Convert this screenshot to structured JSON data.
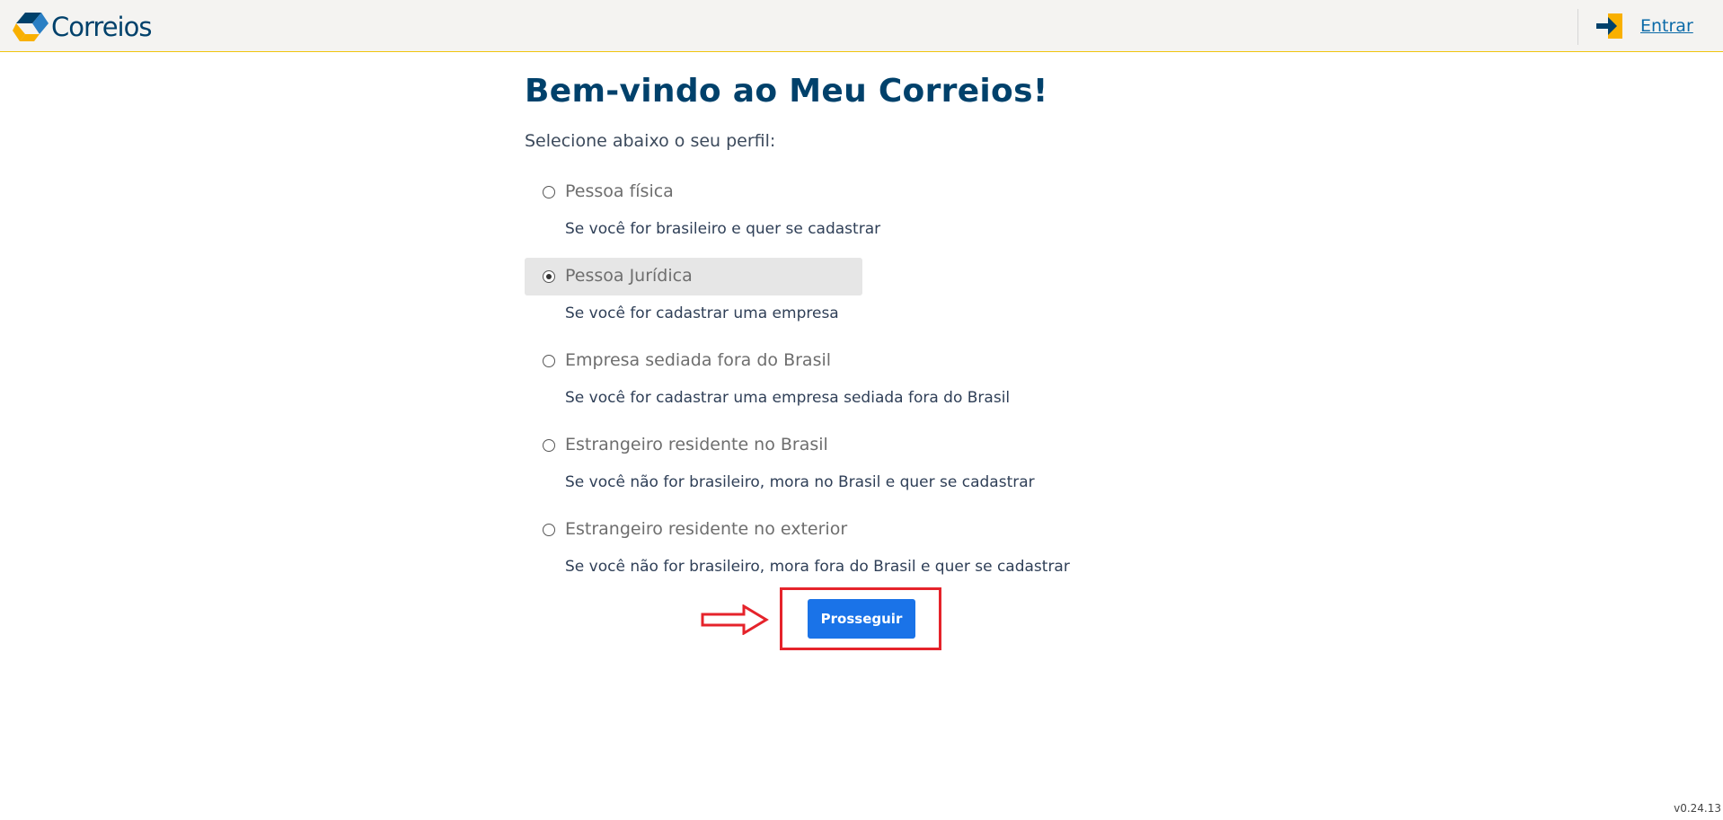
{
  "header": {
    "logo_text": "Correios",
    "login_label": "Entrar"
  },
  "main": {
    "title": "Bem-vindo ao Meu Correios!",
    "subtitle": "Selecione abaixo o seu perfil:",
    "options": [
      {
        "label": "Pessoa física",
        "description": "Se você for brasileiro e quer se cadastrar",
        "selected": false
      },
      {
        "label": "Pessoa Jurídica",
        "description": "Se você for cadastrar uma empresa",
        "selected": true
      },
      {
        "label": "Empresa sediada fora do Brasil",
        "description": "Se você for cadastrar uma empresa sediada fora do Brasil",
        "selected": false
      },
      {
        "label": "Estrangeiro residente no Brasil",
        "description": "Se você não for brasileiro, mora no Brasil e quer se cadastrar",
        "selected": false
      },
      {
        "label": "Estrangeiro residente no exterior",
        "description": "Se você não for brasileiro, mora fora do Brasil e quer se cadastrar",
        "selected": false
      }
    ],
    "proceed_label": "Prosseguir"
  },
  "footer": {
    "version": "v0.24.13"
  },
  "icons": {
    "logo": "correios-logo-icon",
    "login": "login-arrow-icon",
    "annotation": "red-arrow-icon"
  },
  "colors": {
    "brand_blue": "#00416b",
    "brand_yellow": "#f9b000",
    "button_blue": "#1a73e8",
    "annotation_red": "#e5232b",
    "selected_bg": "#e6e6e6"
  }
}
